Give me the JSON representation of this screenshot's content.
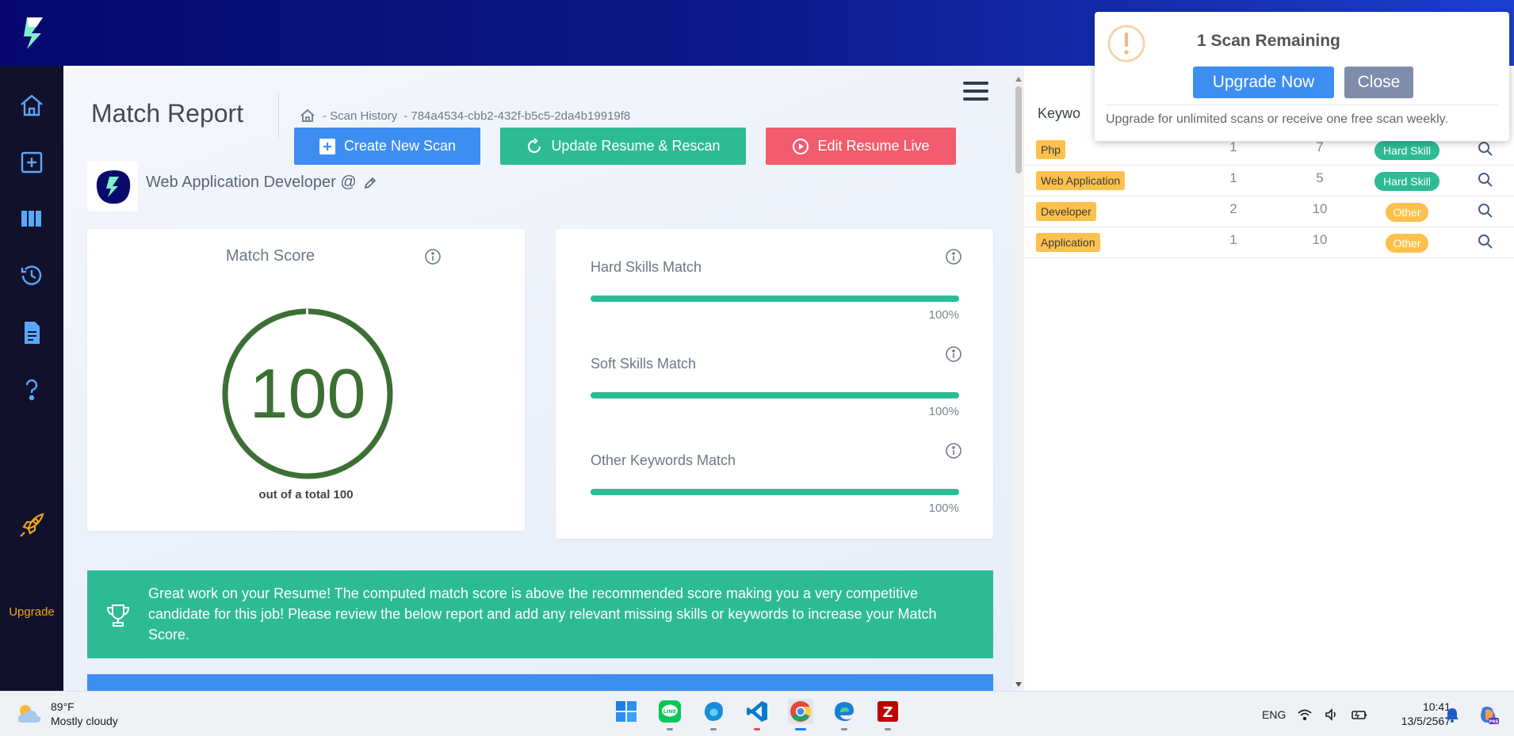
{
  "header": {
    "logo": "jobscan-logo"
  },
  "sidebar": {
    "items": [
      {
        "icon": "home-icon"
      },
      {
        "icon": "add-scan-icon"
      },
      {
        "icon": "board-icon"
      },
      {
        "icon": "history-icon"
      },
      {
        "icon": "document-icon"
      },
      {
        "icon": "help-icon"
      },
      {
        "icon": "rocket-icon",
        "label": "Upgrade"
      }
    ]
  },
  "main": {
    "title": "Match Report",
    "breadcrumb": {
      "history": "- Scan History",
      "scan_id": "- 784a4534-cbb2-432f-b5c5-2da4b19919f8"
    },
    "buttons": {
      "create": "Create New Scan",
      "update": "Update Resume & Rescan",
      "edit": "Edit Resume Live"
    },
    "job_title": "Web Application Developer @",
    "match_score": {
      "title": "Match Score",
      "value": "100",
      "value_num": 100,
      "subtitle": "out of a total 100"
    },
    "skills": [
      {
        "label": "Hard Skills Match",
        "percent": "100%",
        "value": 100
      },
      {
        "label": "Soft Skills Match",
        "percent": "100%",
        "value": 100
      },
      {
        "label": "Other Keywords Match",
        "percent": "100%",
        "value": 100
      }
    ],
    "banner": "Great work on your Resume! The computed match score is above the recommended score making you a very competitive candidate for this job! Please review the below report and add any relevant missing skills or keywords to increase your Match Score."
  },
  "keywords": {
    "heading": "Keywo",
    "rows": [
      {
        "keyword": "Php",
        "resume": "1",
        "job": "7",
        "type": "Hard Skill"
      },
      {
        "keyword": "Web Application",
        "resume": "1",
        "job": "5",
        "type": "Hard Skill"
      },
      {
        "keyword": "Developer",
        "resume": "2",
        "job": "10",
        "type": "Other"
      },
      {
        "keyword": "Application",
        "resume": "1",
        "job": "10",
        "type": "Other"
      }
    ]
  },
  "popup": {
    "title": "1 Scan Remaining",
    "upgrade": "Upgrade Now",
    "close": "Close",
    "message": "Upgrade for unlimited scans or receive one free scan weekly."
  },
  "taskbar": {
    "weather_temp": "89°F",
    "weather_desc": "Mostly cloudy",
    "language": "ENG",
    "time": "10:41",
    "date": "13/5/2567",
    "apps": [
      "windows-start-icon",
      "line-app-icon",
      "edge-beta-icon",
      "vscode-icon",
      "chrome-icon",
      "edge-icon",
      "filezilla-icon"
    ]
  },
  "colors": {
    "accent_blue": "#3d8ef0",
    "accent_green": "#2dbb96",
    "accent_red": "#f25c6e",
    "tag_yellow": "#fcc14d",
    "sidebar": "#11112b",
    "score_green": "#3c6f34"
  }
}
